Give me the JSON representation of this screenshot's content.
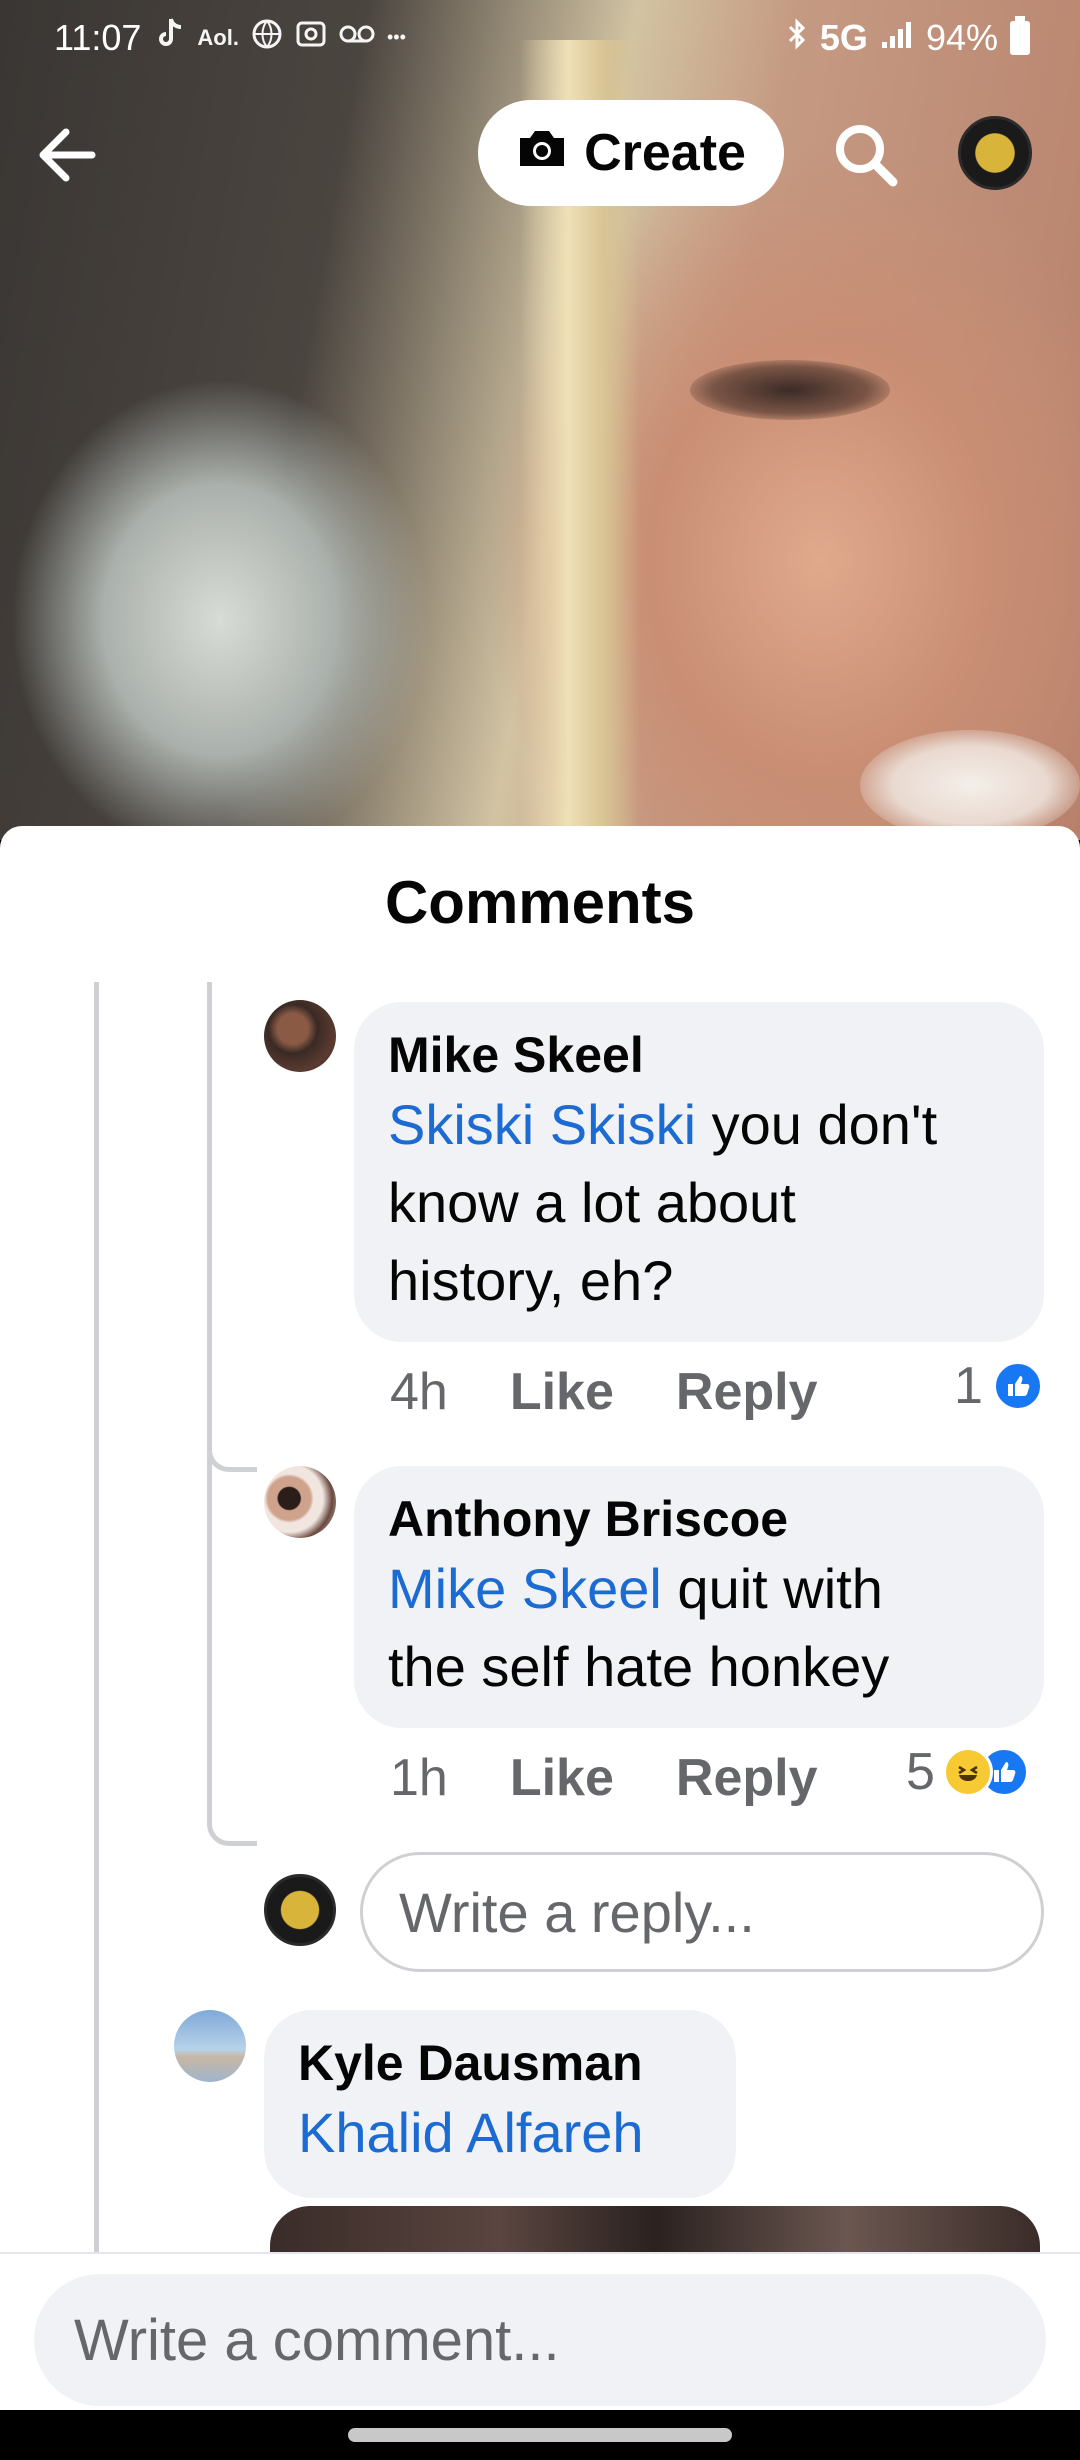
{
  "status_bar": {
    "time": "11:07",
    "left_icons": [
      "tiktok-icon",
      "aol-icon",
      "globe-icon",
      "screenshot-icon",
      "voicemail-icon",
      "more-icon"
    ],
    "aol": "Aol.",
    "more": "•••",
    "network": "5G",
    "battery": "94%"
  },
  "top_nav": {
    "create_label": "Create"
  },
  "sheet": {
    "title": "Comments"
  },
  "comments": [
    {
      "name": "Mike Skeel",
      "mention": "Skiski Skiski",
      "text_line1": " you don't",
      "text_line2": "know a lot about",
      "text_line3": "history, eh?",
      "time": "4h",
      "like_label": "Like",
      "reply_label": "Reply",
      "reaction_count": "1"
    },
    {
      "name": "Anthony Briscoe",
      "mention": "Mike Skeel",
      "text_line1": " quit with",
      "text_line2": "the self hate honkey",
      "time": "1h",
      "like_label": "Like",
      "reply_label": "Reply",
      "reaction_count": "5"
    },
    {
      "name": "Kyle Dausman",
      "mention": "Khalid Alfareh"
    }
  ],
  "reply_input": {
    "placeholder": "Write a reply..."
  },
  "comment_input": {
    "placeholder": "Write a comment..."
  },
  "colors": {
    "mention": "#1b6bd3",
    "bubble": "#f0f2f5",
    "like_blue": "#1877f2"
  }
}
